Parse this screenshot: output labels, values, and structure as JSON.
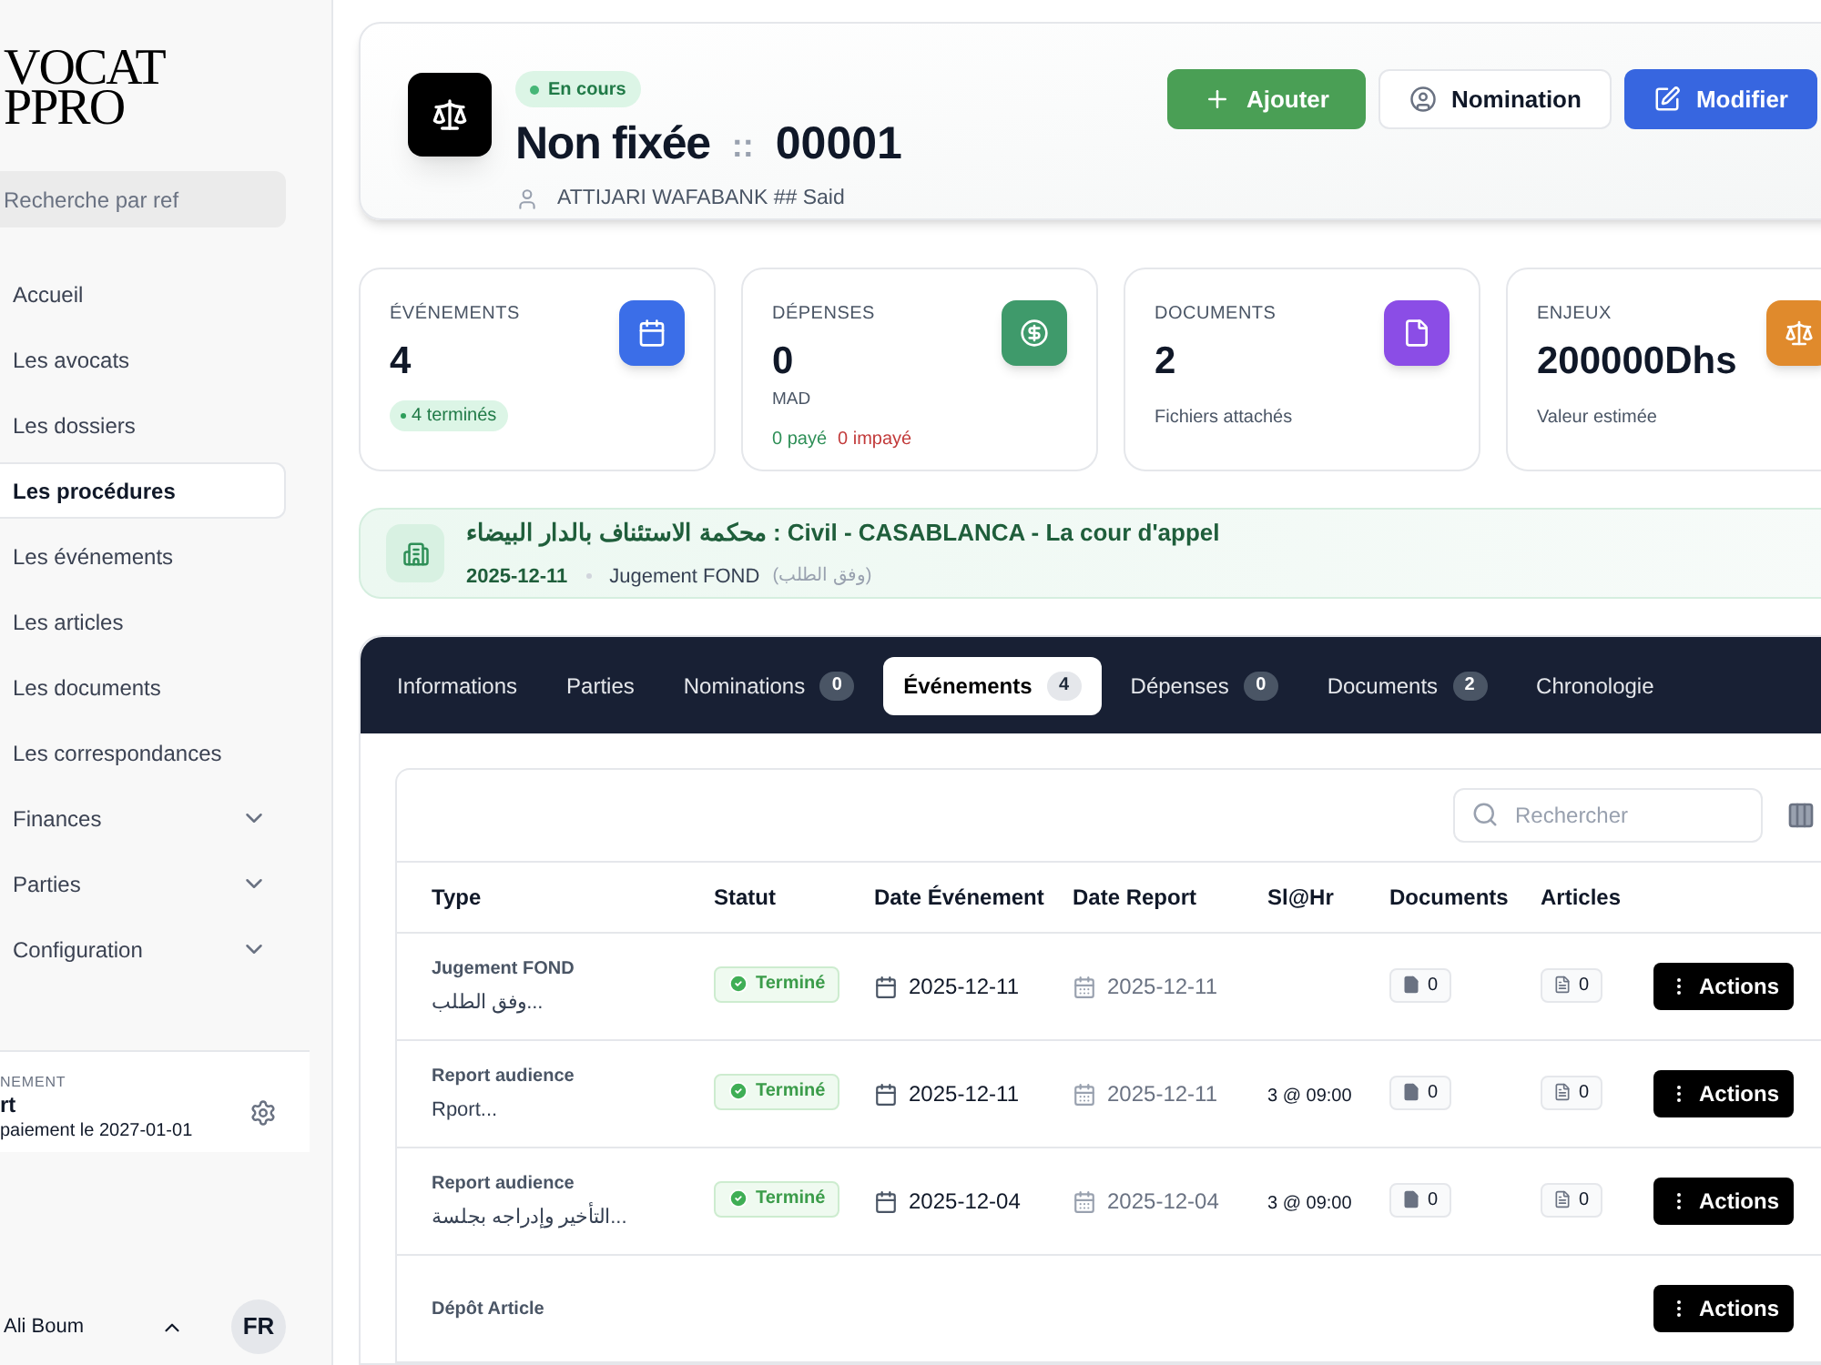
{
  "sidebar": {
    "logo": [
      "VOCAT",
      "PPRO"
    ],
    "search": {
      "placeholder": "Recherche par ref"
    },
    "items": [
      {
        "label": "Accueil",
        "selected": false,
        "expandable": false
      },
      {
        "label": "Les avocats",
        "selected": false,
        "expandable": false
      },
      {
        "label": "Les dossiers",
        "selected": false,
        "expandable": false
      },
      {
        "label": "Les procédures",
        "selected": true,
        "expandable": false
      },
      {
        "label": "Les événements",
        "selected": false,
        "expandable": false
      },
      {
        "label": "Les articles",
        "selected": false,
        "expandable": false
      },
      {
        "label": "Les documents",
        "selected": false,
        "expandable": false
      },
      {
        "label": "Les correspondances",
        "selected": false,
        "expandable": false
      },
      {
        "label": "Finances",
        "selected": false,
        "expandable": true
      },
      {
        "label": "Parties",
        "selected": false,
        "expandable": true
      },
      {
        "label": "Configuration",
        "selected": false,
        "expandable": true
      }
    ],
    "subscription": {
      "label": "NEMENT",
      "plan": "rt",
      "note": "paiement le 2027-01-01"
    },
    "user": {
      "name": "Ali Boum",
      "language": "FR"
    }
  },
  "header": {
    "status": "En cours",
    "title": "Non fixée",
    "separator": "::",
    "number": "00001",
    "client": "ATTIJARI WAFABANK ## Said",
    "buttons": [
      {
        "label": "Ajouter",
        "kind": "add"
      },
      {
        "label": "Nomination",
        "kind": "nomination"
      },
      {
        "label": "Modifier",
        "kind": "edit"
      }
    ]
  },
  "stats": [
    {
      "kind": "events",
      "label": "ÉVÉNEMENTS",
      "value": "4",
      "badge": "4 terminés",
      "color": "#3b6ee8"
    },
    {
      "kind": "expenses",
      "label": "DÉPENSES",
      "value": "0",
      "unit": "MAD",
      "paid": "0 payé",
      "unpaid": "0 impayé",
      "color": "#3f9a6b"
    },
    {
      "kind": "documents",
      "label": "DOCUMENTS",
      "value": "2",
      "note": "Fichiers attachés",
      "color": "#8b4de6"
    },
    {
      "kind": "stakes",
      "label": "ENJEUX",
      "value": "200000Dhs",
      "note": "Valeur estimée",
      "color": "#e08a2c"
    }
  ],
  "court": {
    "title": "محكمة الاستئناف بالدار البيضاء : Civil - CASABLANCA - La cour d'appel",
    "date": "2025-12-11",
    "type": "Jugement FOND",
    "detail": "(وفق الطلب)"
  },
  "tabs": [
    {
      "label": "Informations",
      "selected": false
    },
    {
      "label": "Parties",
      "selected": false
    },
    {
      "label": "Nominations",
      "count": "0",
      "selected": false
    },
    {
      "label": "Événements",
      "count": "4",
      "selected": true
    },
    {
      "label": "Dépenses",
      "count": "0",
      "selected": false
    },
    {
      "label": "Documents",
      "count": "2",
      "selected": false
    },
    {
      "label": "Chronologie",
      "selected": false
    }
  ],
  "table": {
    "search": {
      "placeholder": "Rechercher"
    },
    "columns": [
      "Type",
      "Statut",
      "Date Événement",
      "Date Report",
      "Sl@Hr",
      "Documents",
      "Articles"
    ],
    "rows": [
      {
        "type": "Jugement FOND",
        "description": "وفق الطلب...",
        "status": "Terminé",
        "date": "2025-12-11",
        "report": "2025-12-11",
        "slot": "",
        "documents": "0",
        "articles": "0",
        "action": "Actions"
      },
      {
        "type": "Report audience",
        "description": "Rport...",
        "status": "Terminé",
        "date": "2025-12-11",
        "report": "2025-12-11",
        "slot": "3 @ 09:00",
        "documents": "0",
        "articles": "0",
        "action": "Actions"
      },
      {
        "type": "Report audience",
        "description": "التأخير وإدراجه بجلسة...",
        "status": "Terminé",
        "date": "2025-12-04",
        "report": "2025-12-04",
        "slot": "3 @ 09:00",
        "documents": "0",
        "articles": "0",
        "action": "Actions"
      },
      {
        "type": "Dépôt Article",
        "action": "Actions"
      }
    ]
  }
}
